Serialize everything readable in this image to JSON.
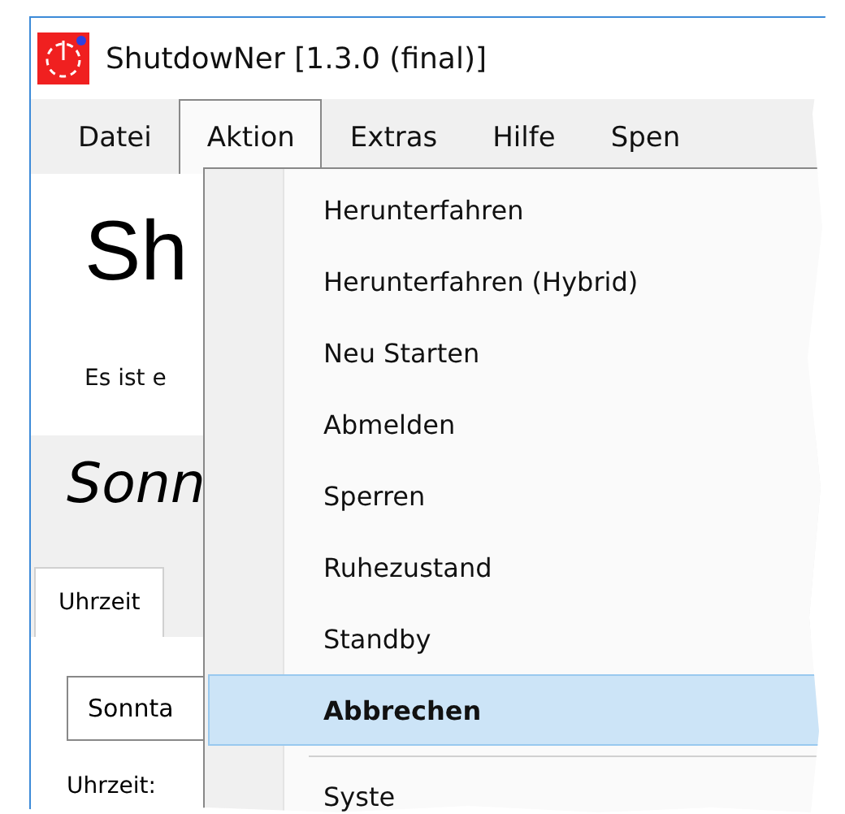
{
  "window": {
    "title": "ShutdowNer [1.3.0 (final)]"
  },
  "menubar": [
    {
      "label": "Datei",
      "selected": false
    },
    {
      "label": "Aktion",
      "selected": true
    },
    {
      "label": "Extras",
      "selected": false
    },
    {
      "label": "Hilfe",
      "selected": false
    },
    {
      "label": "Spen",
      "selected": false
    }
  ],
  "menu": [
    {
      "label": "Herunterfahren",
      "selected": false
    },
    {
      "label": "Herunterfahren (Hybrid)",
      "selected": false
    },
    {
      "label": "Neu Starten",
      "selected": false
    },
    {
      "label": "Abmelden",
      "selected": false
    },
    {
      "label": "Sperren",
      "selected": false
    },
    {
      "label": "Ruhezustand",
      "selected": false
    },
    {
      "label": "Standby",
      "selected": false
    },
    {
      "label": "Abbrechen",
      "selected": true,
      "default": true
    },
    {
      "kind": "separator"
    },
    {
      "label": "Syste",
      "selected": false
    }
  ],
  "content": {
    "heading": "Sh",
    "message": "Es ist e",
    "day_heading": "Sonn",
    "tabs": [
      {
        "label": "Uhrzeit",
        "selected": true
      }
    ],
    "day_select": {
      "value": "Sonnta"
    },
    "time_label": "Uhrzeit:"
  }
}
